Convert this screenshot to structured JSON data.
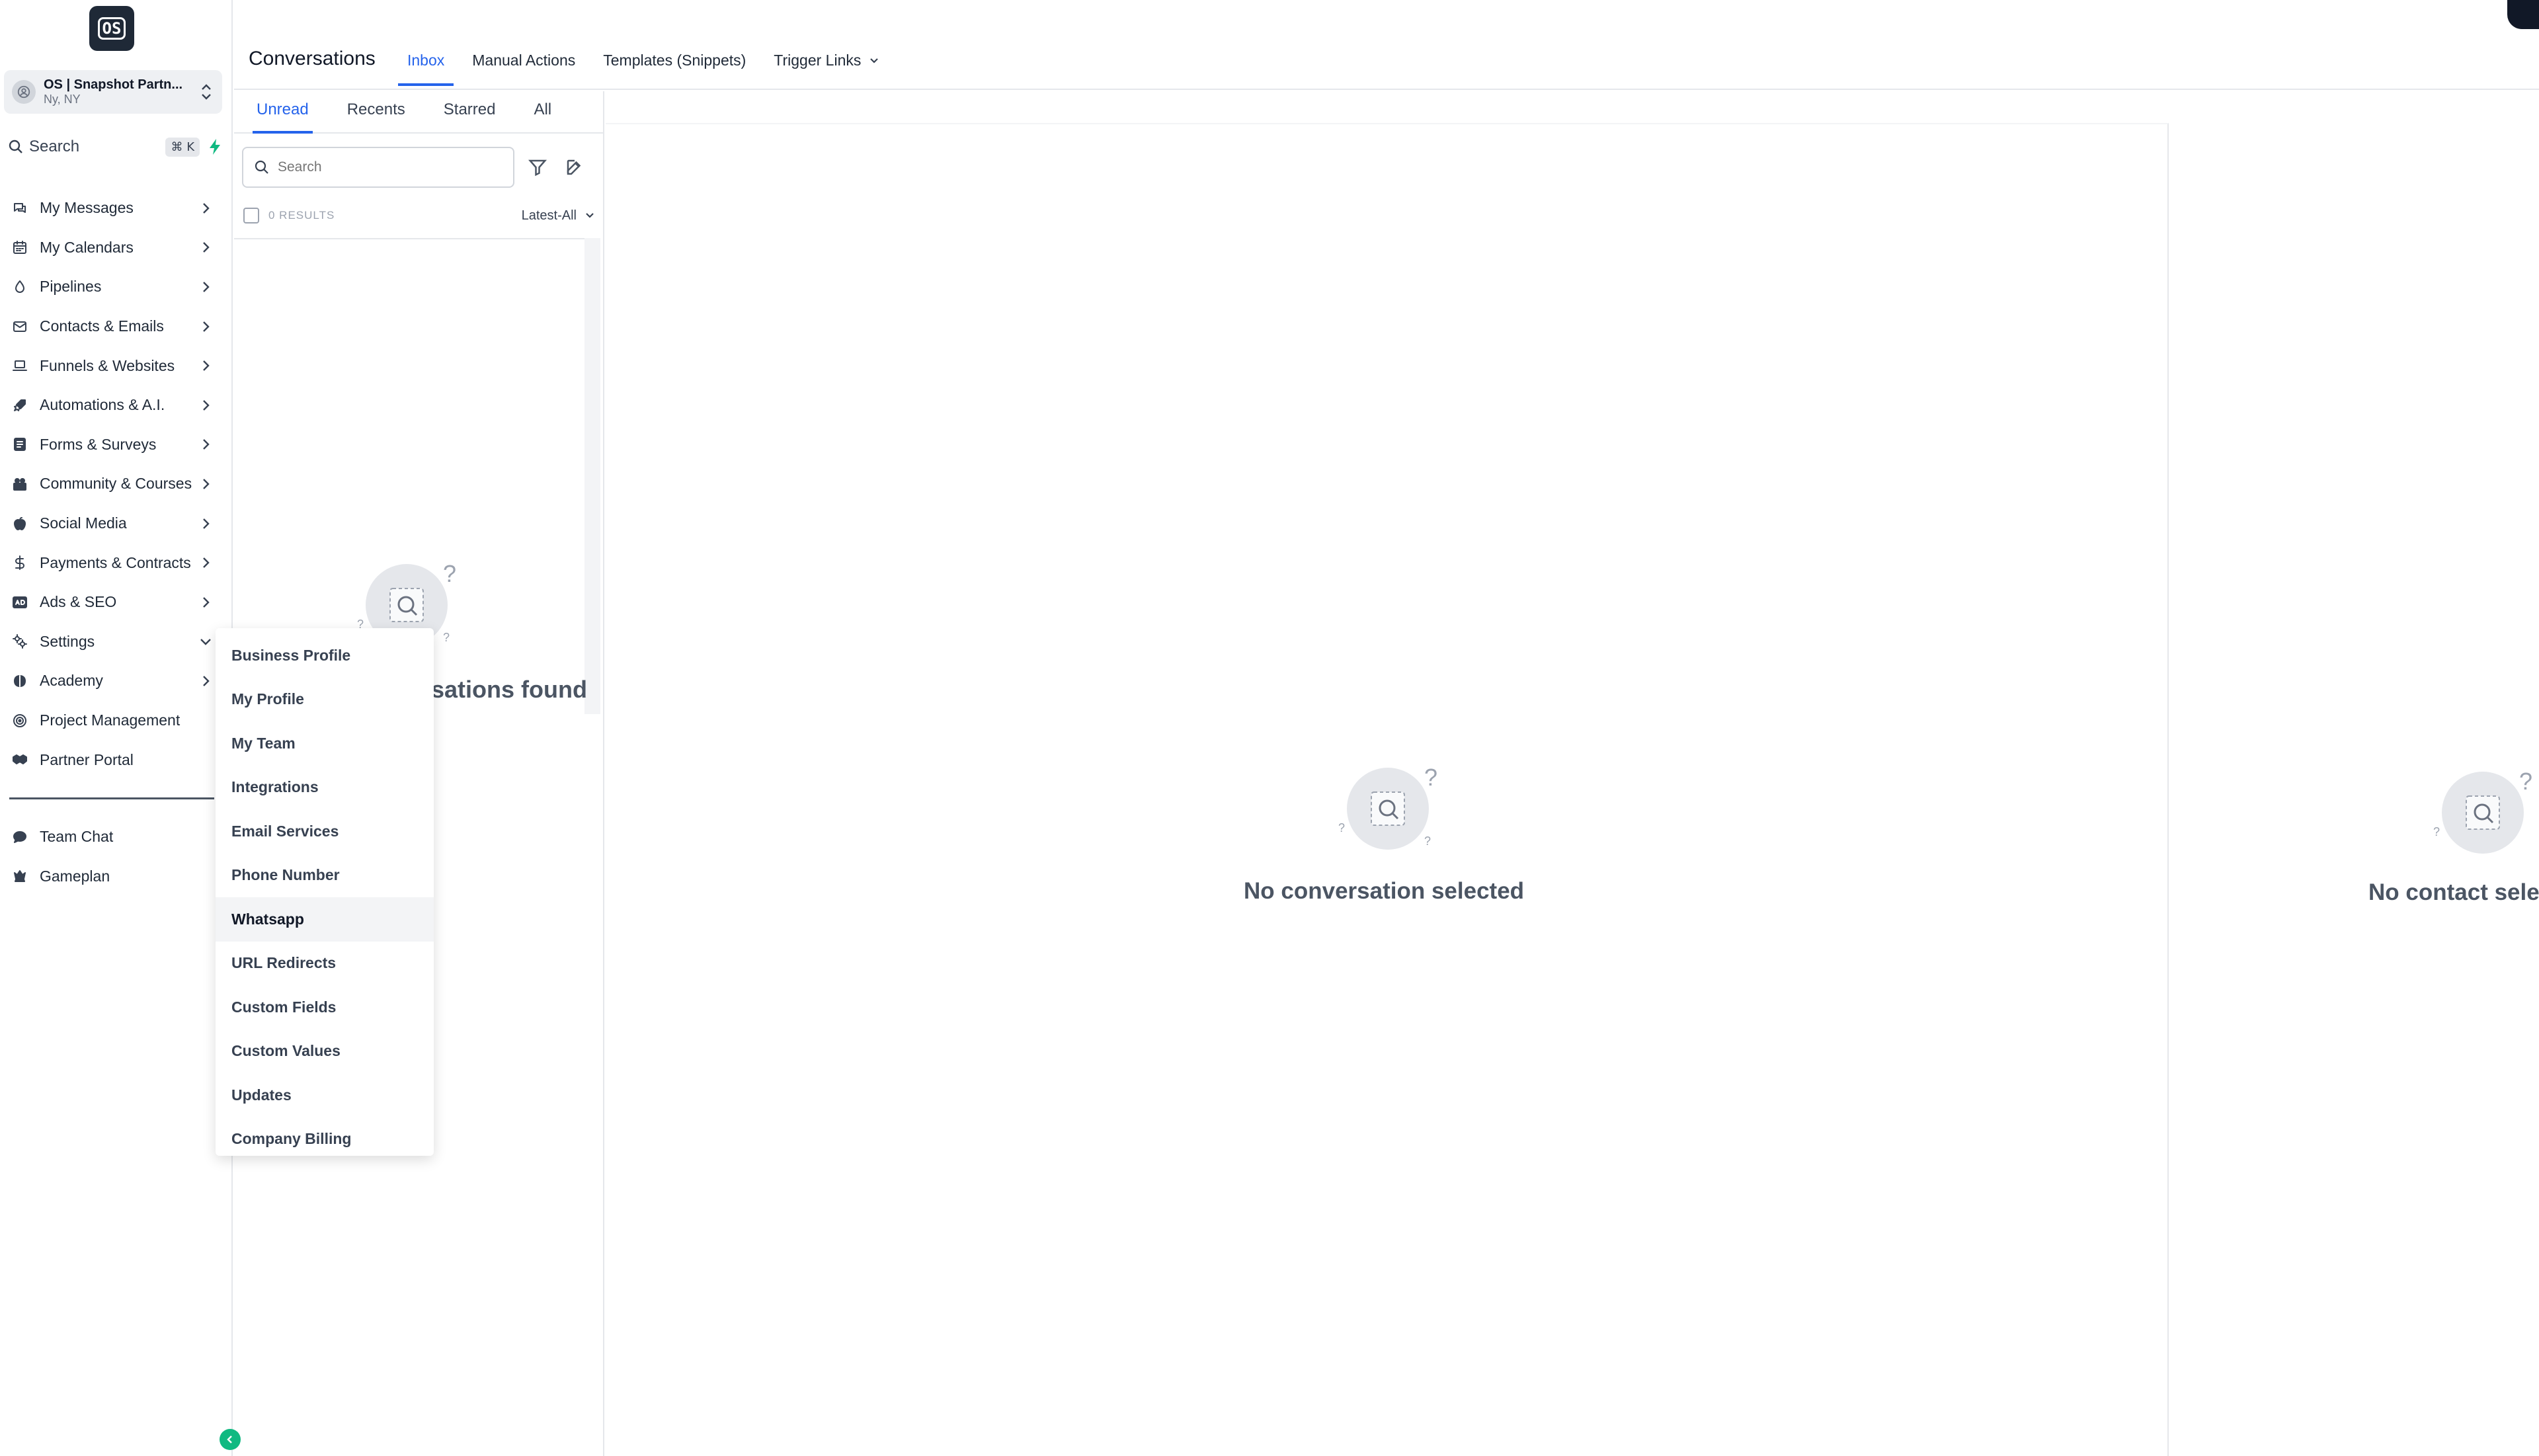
{
  "sidebar": {
    "logo_text": "OS",
    "account": {
      "name": "OS | Snapshot Partn...",
      "location": "Ny, NY"
    },
    "search": {
      "label": "Search",
      "shortcut": "⌘ K"
    },
    "items": [
      {
        "label": "My Messages",
        "icon": "chat-icon"
      },
      {
        "label": "My Calendars",
        "icon": "calendar-icon"
      },
      {
        "label": "Pipelines",
        "icon": "droplet-icon"
      },
      {
        "label": "Contacts & Emails",
        "icon": "mail-icon"
      },
      {
        "label": "Funnels & Websites",
        "icon": "laptop-icon"
      },
      {
        "label": "Automations & A.I.",
        "icon": "rocket-icon"
      },
      {
        "label": "Forms & Surveys",
        "icon": "form-icon"
      },
      {
        "label": "Community & Courses",
        "icon": "community-icon"
      },
      {
        "label": "Social Media",
        "icon": "apple-icon"
      },
      {
        "label": "Payments & Contracts",
        "icon": "dollar-icon"
      },
      {
        "label": "Ads & SEO",
        "icon": "ads-icon"
      },
      {
        "label": "Settings",
        "icon": "gears-icon"
      },
      {
        "label": "Academy",
        "icon": "brain-icon"
      },
      {
        "label": "Project Management",
        "icon": "target-icon"
      },
      {
        "label": "Partner Portal",
        "icon": "handshake-icon"
      }
    ],
    "bottom_items": [
      {
        "label": "Team Chat",
        "icon": "chat-bubble-icon"
      },
      {
        "label": "Gameplan",
        "icon": "chess-icon"
      }
    ]
  },
  "header": {
    "title": "Conversations",
    "tabs": [
      {
        "label": "Inbox"
      },
      {
        "label": "Manual Actions"
      },
      {
        "label": "Templates (Snippets)"
      },
      {
        "label": "Trigger Links"
      }
    ]
  },
  "list": {
    "tabs": [
      {
        "label": "Unread"
      },
      {
        "label": "Recents"
      },
      {
        "label": "Starred"
      },
      {
        "label": "All"
      }
    ],
    "search_placeholder": "Search",
    "results_count": "0 RESULTS",
    "sort_label": "Latest-All",
    "empty_text": "sations found"
  },
  "main": {
    "empty_text": "No conversation selected",
    "contact_empty_text": "No contact sele"
  },
  "settings_menu": {
    "items": [
      {
        "label": "Business Profile"
      },
      {
        "label": "My Profile"
      },
      {
        "label": "My Team"
      },
      {
        "label": "Integrations"
      },
      {
        "label": "Email Services"
      },
      {
        "label": "Phone Number"
      },
      {
        "label": "Whatsapp"
      },
      {
        "label": "URL Redirects"
      },
      {
        "label": "Custom Fields"
      },
      {
        "label": "Custom Values"
      },
      {
        "label": "Updates"
      },
      {
        "label": "Company Billing"
      }
    ]
  },
  "colors": {
    "accent": "#2563eb",
    "success": "#10b981",
    "text": "#1f2937",
    "muted": "#6b7280"
  }
}
